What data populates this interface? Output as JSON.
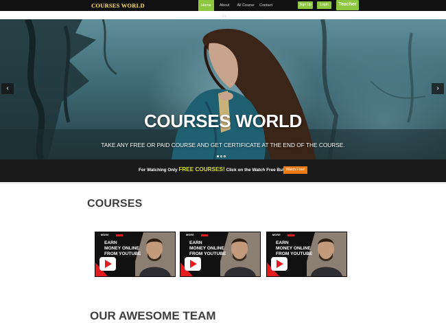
{
  "brand": {
    "logo_text": "COURSES WORLD"
  },
  "nav": {
    "items": [
      "Home",
      "About Us",
      "All Course",
      "Contact"
    ],
    "signup_label": "Sign Up",
    "login_label": "Login",
    "teacher_label": "Teacher"
  },
  "hero": {
    "title": "COURSES WORLD",
    "subtitle": "TAKE ANY FREE OR PAID COURSE AND GET CERTIFICATE AT THE END OF THE COURSE.",
    "prev_icon": "chevron-left-icon",
    "next_icon": "chevron-right-icon",
    "slide_count": 3,
    "active_slide": 1
  },
  "promo": {
    "text_before": "For Watching Only ",
    "highlight": "FREE COURSES!",
    "text_after": " Click on the Watch Free Button => ",
    "button_label": "Watch Free!"
  },
  "courses": {
    "title": "COURSES",
    "cards": [
      {
        "tag": "MORE",
        "lines": [
          "EARN",
          "MONEY ONLINE",
          "FROM YOUTUBE"
        ],
        "icon": "youtube-play-icon"
      },
      {
        "tag": "MORE",
        "lines": [
          "EARN",
          "MONEY ONLINE",
          "FROM YOUTUBE"
        ],
        "icon": "youtube-play-icon"
      },
      {
        "tag": "MORE",
        "lines": [
          "EARN",
          "MONEY ONLINE",
          "FROM YOUTUBE"
        ],
        "icon": "youtube-play-icon"
      }
    ]
  },
  "team": {
    "title": "OUR AWESOME TEAM"
  },
  "colors": {
    "accent_green": "#8dc63f",
    "promo_orange": "#f07b12",
    "promo_highlight": "#d4e021",
    "nav_bg": "#111111",
    "youtube_red": "#e31d1d"
  }
}
